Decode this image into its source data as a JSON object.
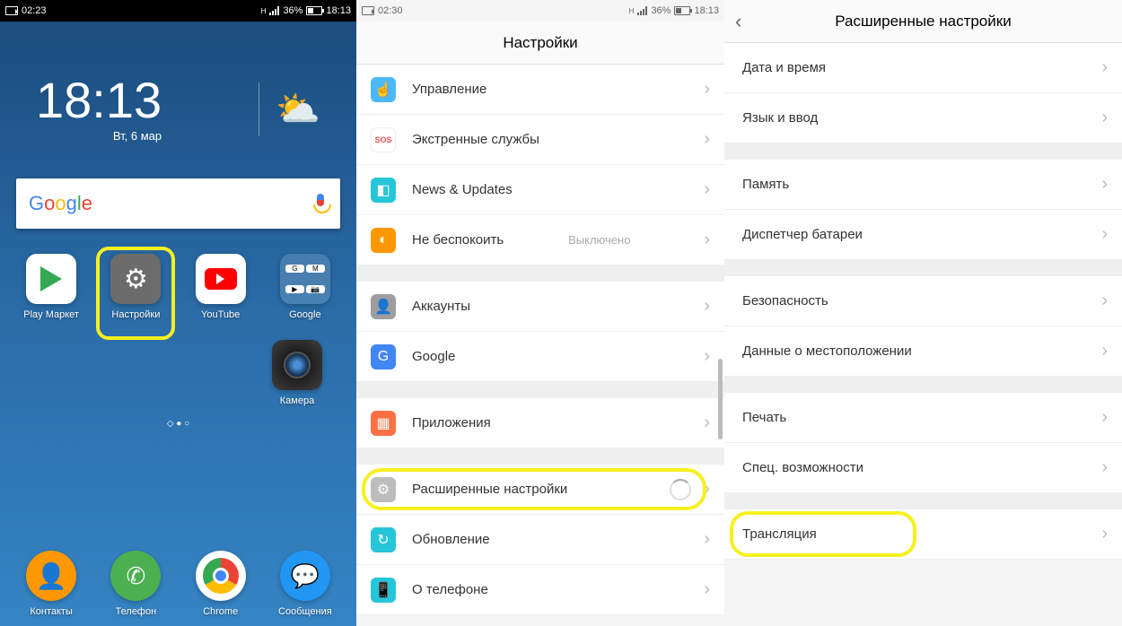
{
  "panel1": {
    "status": {
      "rec_time": "02:23",
      "battery_pct": "36%",
      "clock": "18:13"
    },
    "home": {
      "time": "18:13",
      "date": "Вт, 6 мар"
    },
    "search_logo": "Google",
    "apps_row1": [
      {
        "label": "Play Маркет",
        "icon": "play"
      },
      {
        "label": "Настройки",
        "icon": "gear",
        "highlighted": true
      },
      {
        "label": "YouTube",
        "icon": "youtube"
      },
      {
        "label": "Google",
        "icon": "folder"
      }
    ],
    "apps_row2_camera": "Камера",
    "dock": [
      {
        "label": "Контакты",
        "icon": "contacts"
      },
      {
        "label": "Телефон",
        "icon": "phone"
      },
      {
        "label": "Chrome",
        "icon": "chrome"
      },
      {
        "label": "Сообщения",
        "icon": "messages"
      }
    ]
  },
  "panel2": {
    "status": {
      "rec_time": "02:30",
      "battery_pct": "36%",
      "clock": "18:13"
    },
    "title": "Настройки",
    "items": [
      {
        "label": "Управление",
        "color": "#4db8ff",
        "glyph": "☝"
      },
      {
        "label": "Экстренные службы",
        "color": "#ff5252",
        "glyph": "sos"
      },
      {
        "label": "News & Updates",
        "color": "#26c6da",
        "glyph": "◧"
      },
      {
        "label": "Не беспокоить",
        "color": "#ff9800",
        "glyph": "◐",
        "value": "Выключено"
      }
    ],
    "items2": [
      {
        "label": "Аккаунты",
        "color": "#9e9e9e",
        "glyph": "👤"
      },
      {
        "label": "Google",
        "color": "#4285f4",
        "glyph": "G"
      }
    ],
    "items3": [
      {
        "label": "Приложения",
        "color": "#ff7043",
        "glyph": "▦"
      }
    ],
    "items4": [
      {
        "label": "Расширенные настройки",
        "color": "#bdbdbd",
        "glyph": "⚙",
        "highlighted": true,
        "spinner": true
      },
      {
        "label": "Обновление",
        "color": "#26c6da",
        "glyph": "↻"
      },
      {
        "label": "О телефоне",
        "color": "#26c6da",
        "glyph": "📱"
      }
    ]
  },
  "panel3": {
    "title": "Расширенные настройки",
    "groups": [
      [
        "Дата и время",
        "Язык и ввод"
      ],
      [
        "Память",
        "Диспетчер батареи"
      ],
      [
        "Безопасность",
        "Данные о местоположении"
      ],
      [
        "Печать",
        "Спец. возможности"
      ]
    ],
    "last_item": "Трансляция"
  }
}
